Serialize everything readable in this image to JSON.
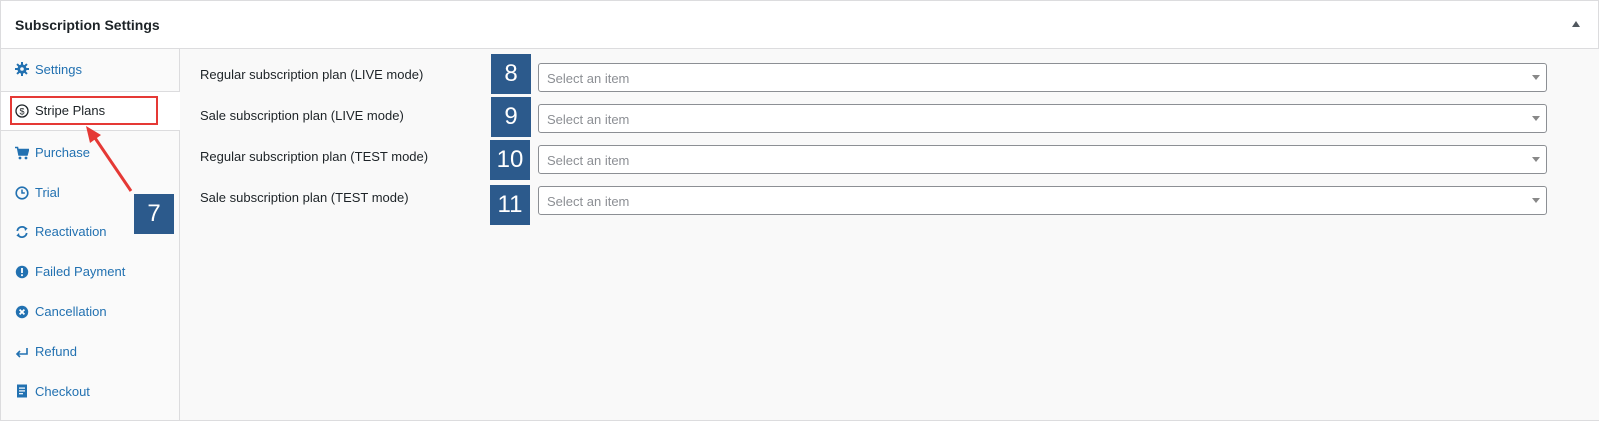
{
  "panel": {
    "title": "Subscription Settings",
    "toggle_icon": "triangle-up-icon"
  },
  "sidebar": {
    "items": [
      {
        "label": "Settings",
        "icon": "gear-icon",
        "active": false
      },
      {
        "label": "Stripe Plans",
        "icon": "dollar-circle-icon",
        "active": true
      },
      {
        "label": "Purchase",
        "icon": "cart-icon",
        "active": false
      },
      {
        "label": "Trial",
        "icon": "clock-icon",
        "active": false
      },
      {
        "label": "Reactivation",
        "icon": "refresh-icon",
        "active": false
      },
      {
        "label": "Failed Payment",
        "icon": "exclamation-circle-icon",
        "active": false
      },
      {
        "label": "Cancellation",
        "icon": "x-circle-icon",
        "active": false
      },
      {
        "label": "Refund",
        "icon": "return-arrow-icon",
        "active": false
      },
      {
        "label": "Checkout",
        "icon": "document-icon",
        "active": false
      }
    ]
  },
  "main": {
    "rows": [
      {
        "label": "Regular subscription plan (LIVE mode)",
        "placeholder": "Select an item"
      },
      {
        "label": "Sale subscription plan (LIVE mode)",
        "placeholder": "Select an item"
      },
      {
        "label": "Regular subscription plan (TEST mode)",
        "placeholder": "Select an item"
      },
      {
        "label": "Sale subscription plan (TEST mode)",
        "placeholder": "Select an item"
      }
    ]
  },
  "annotations": {
    "badges": [
      "7",
      "8",
      "9",
      "10",
      "11"
    ],
    "highlight_color": "#e53935",
    "badge_color": "#2c5a8c"
  },
  "colors": {
    "link": "#2271b1",
    "text": "#1d2327",
    "border": "#dcdcde"
  }
}
